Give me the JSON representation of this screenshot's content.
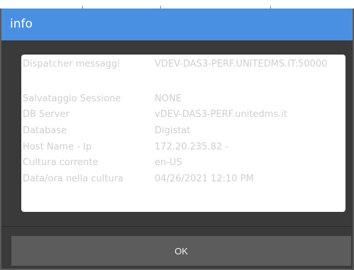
{
  "dialog": {
    "title": "info",
    "ok_label": "OK"
  },
  "info": {
    "rows": [
      {
        "label": "Dispatcher messaggi",
        "value": "VDEV-DAS3-PERF.UNITEDMS.IT:50000"
      },
      {
        "label": "Salvataggio Sessione",
        "value": "NONE"
      },
      {
        "label": "DB Server",
        "value": "vDEV-DAS3-PERF.unitedms.it"
      },
      {
        "label": "Database",
        "value": "Digistat"
      },
      {
        "label": "Host Name - Ip",
        "value": "172.20.235.82  -"
      },
      {
        "label": "Cultura corrente",
        "value": "en-US"
      },
      {
        "label": "Data/ora nella cultura",
        "value": "04/26/2021 12:10 PM"
      }
    ]
  },
  "colors": {
    "titlebar": "#4a90e2",
    "dialog_background": "#3a3a3a",
    "button_background": "#5c5c5c",
    "panel_background": "#ffffff",
    "text_faint": "#cfcfcf"
  }
}
